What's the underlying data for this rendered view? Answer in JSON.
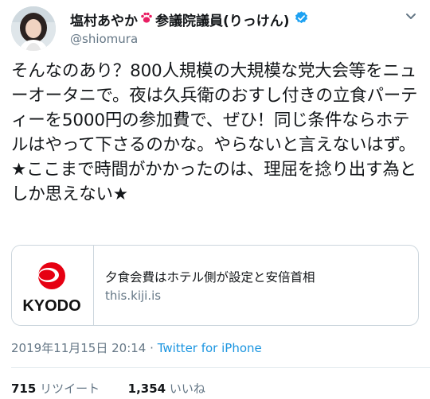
{
  "author": {
    "display_name": "塩村あやか",
    "display_name_suffix": "参議院議員(りっけん)",
    "handle": "@shiomura"
  },
  "tweet": {
    "text": "そんなのあり？800人規模の大規模な党大会等をニューオータニで。夜は久兵衛のおすし付きの立食パーティーを5000円の参加費で、ぜひ！同じ条件ならホテルはやって下さるのかな。やらないと言えないはず。\n★ここまで時間がかかったのは、理屈を捻り出す為としか思えない★"
  },
  "card": {
    "logo_text": "KYODO",
    "title": "夕食会費はホテル側が設定と安倍首相",
    "domain": "this.kiji.is"
  },
  "meta": {
    "timestamp": "2019年11月15日 20:14",
    "separator": "·",
    "source": "Twitter for iPhone"
  },
  "stats": {
    "retweets_count": "715",
    "retweets_label": "リツイート",
    "likes_count": "1,354",
    "likes_label": "いいね"
  },
  "colors": {
    "text": "#14171a",
    "secondary": "#657786",
    "link": "#1b95e0",
    "verified": "#1da1f2",
    "kyodo_red": "#e60012",
    "paw": "#e91e63"
  },
  "icons": [
    "avatar",
    "paw-icon",
    "verified-badge-icon",
    "more-chevron-icon",
    "kyodo-logo"
  ]
}
